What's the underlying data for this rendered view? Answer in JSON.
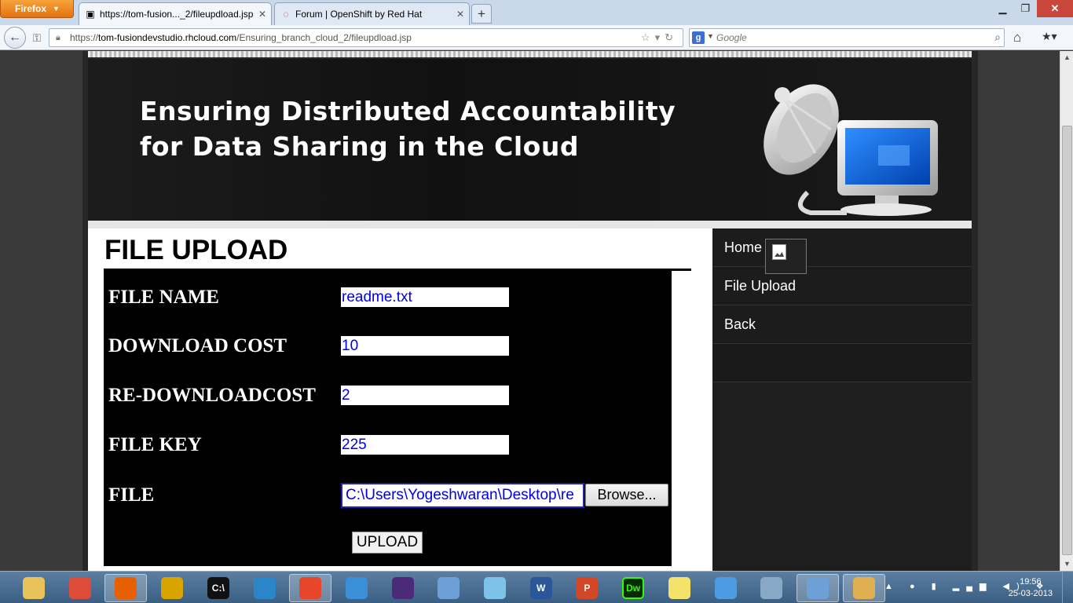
{
  "browser": {
    "menu_button": "Firefox",
    "tabs": [
      {
        "title": "https://tom-fusion..._2/fileupdload.jsp",
        "active": true
      },
      {
        "title": "Forum | OpenShift by Red Hat",
        "active": false
      }
    ],
    "url_prefix": "https://",
    "url_host": "tom-fusiondevstudio.rhcloud.com",
    "url_path": "/Ensuring_branch_cloud_2/fileupdload.jsp",
    "search_placeholder": "Google"
  },
  "site": {
    "title_line1": "Ensuring Distributed Accountability",
    "title_line2": "for Data Sharing in the Cloud"
  },
  "form": {
    "heading": "FILE UPLOAD",
    "fields": [
      {
        "label": "FILE NAME",
        "value": "readme.txt"
      },
      {
        "label": "DOWNLOAD COST",
        "value": "10"
      },
      {
        "label": "RE-DOWNLOADCOST",
        "value": "2"
      },
      {
        "label": "FILE KEY",
        "value": "225"
      }
    ],
    "file_label": "FILE",
    "file_path": "C:\\Users\\Yogeshwaran\\Desktop\\re",
    "browse_label": "Browse...",
    "upload_label": "UPLOAD"
  },
  "sidebar": {
    "items": [
      {
        "label": "Home"
      },
      {
        "label": "File Upload"
      },
      {
        "label": "Back"
      }
    ]
  },
  "taskbar": {
    "apps": [
      {
        "name": "explorer-icon",
        "color": "#e8c25a"
      },
      {
        "name": "chrome-icon",
        "color": "#dd4b39"
      },
      {
        "name": "firefox-icon",
        "color": "#e66000"
      },
      {
        "name": "filezilla-icon",
        "color": "#d8a400"
      },
      {
        "name": "cmd-icon",
        "color": "#111111",
        "text": "C:\\"
      },
      {
        "name": "app-icon",
        "color": "#2a86c9"
      },
      {
        "name": "git-icon",
        "color": "#e8462b"
      },
      {
        "name": "itunes-icon",
        "color": "#3a8fd8"
      },
      {
        "name": "eclipse-icon",
        "color": "#4b2a7a"
      },
      {
        "name": "virtualbox-icon",
        "color": "#6ea0d8"
      },
      {
        "name": "notepad-icon",
        "color": "#7dc2e8"
      },
      {
        "name": "word-icon",
        "color": "#2b579a",
        "text": "W"
      },
      {
        "name": "powerpoint-icon",
        "color": "#d24726",
        "text": "P"
      },
      {
        "name": "dreamweaver-icon",
        "color": "#35fa00",
        "text": "Dw"
      },
      {
        "name": "sticky-notes-icon",
        "color": "#f4e36a"
      },
      {
        "name": "control-panel-icon",
        "color": "#4d9be0"
      },
      {
        "name": "task-manager-icon",
        "color": "#88a8c8"
      },
      {
        "name": "virtualbox-running-icon",
        "color": "#6ea0d8"
      },
      {
        "name": "paint-icon",
        "color": "#e0b050"
      }
    ],
    "time": "19:56",
    "date": "25-03-2013"
  }
}
